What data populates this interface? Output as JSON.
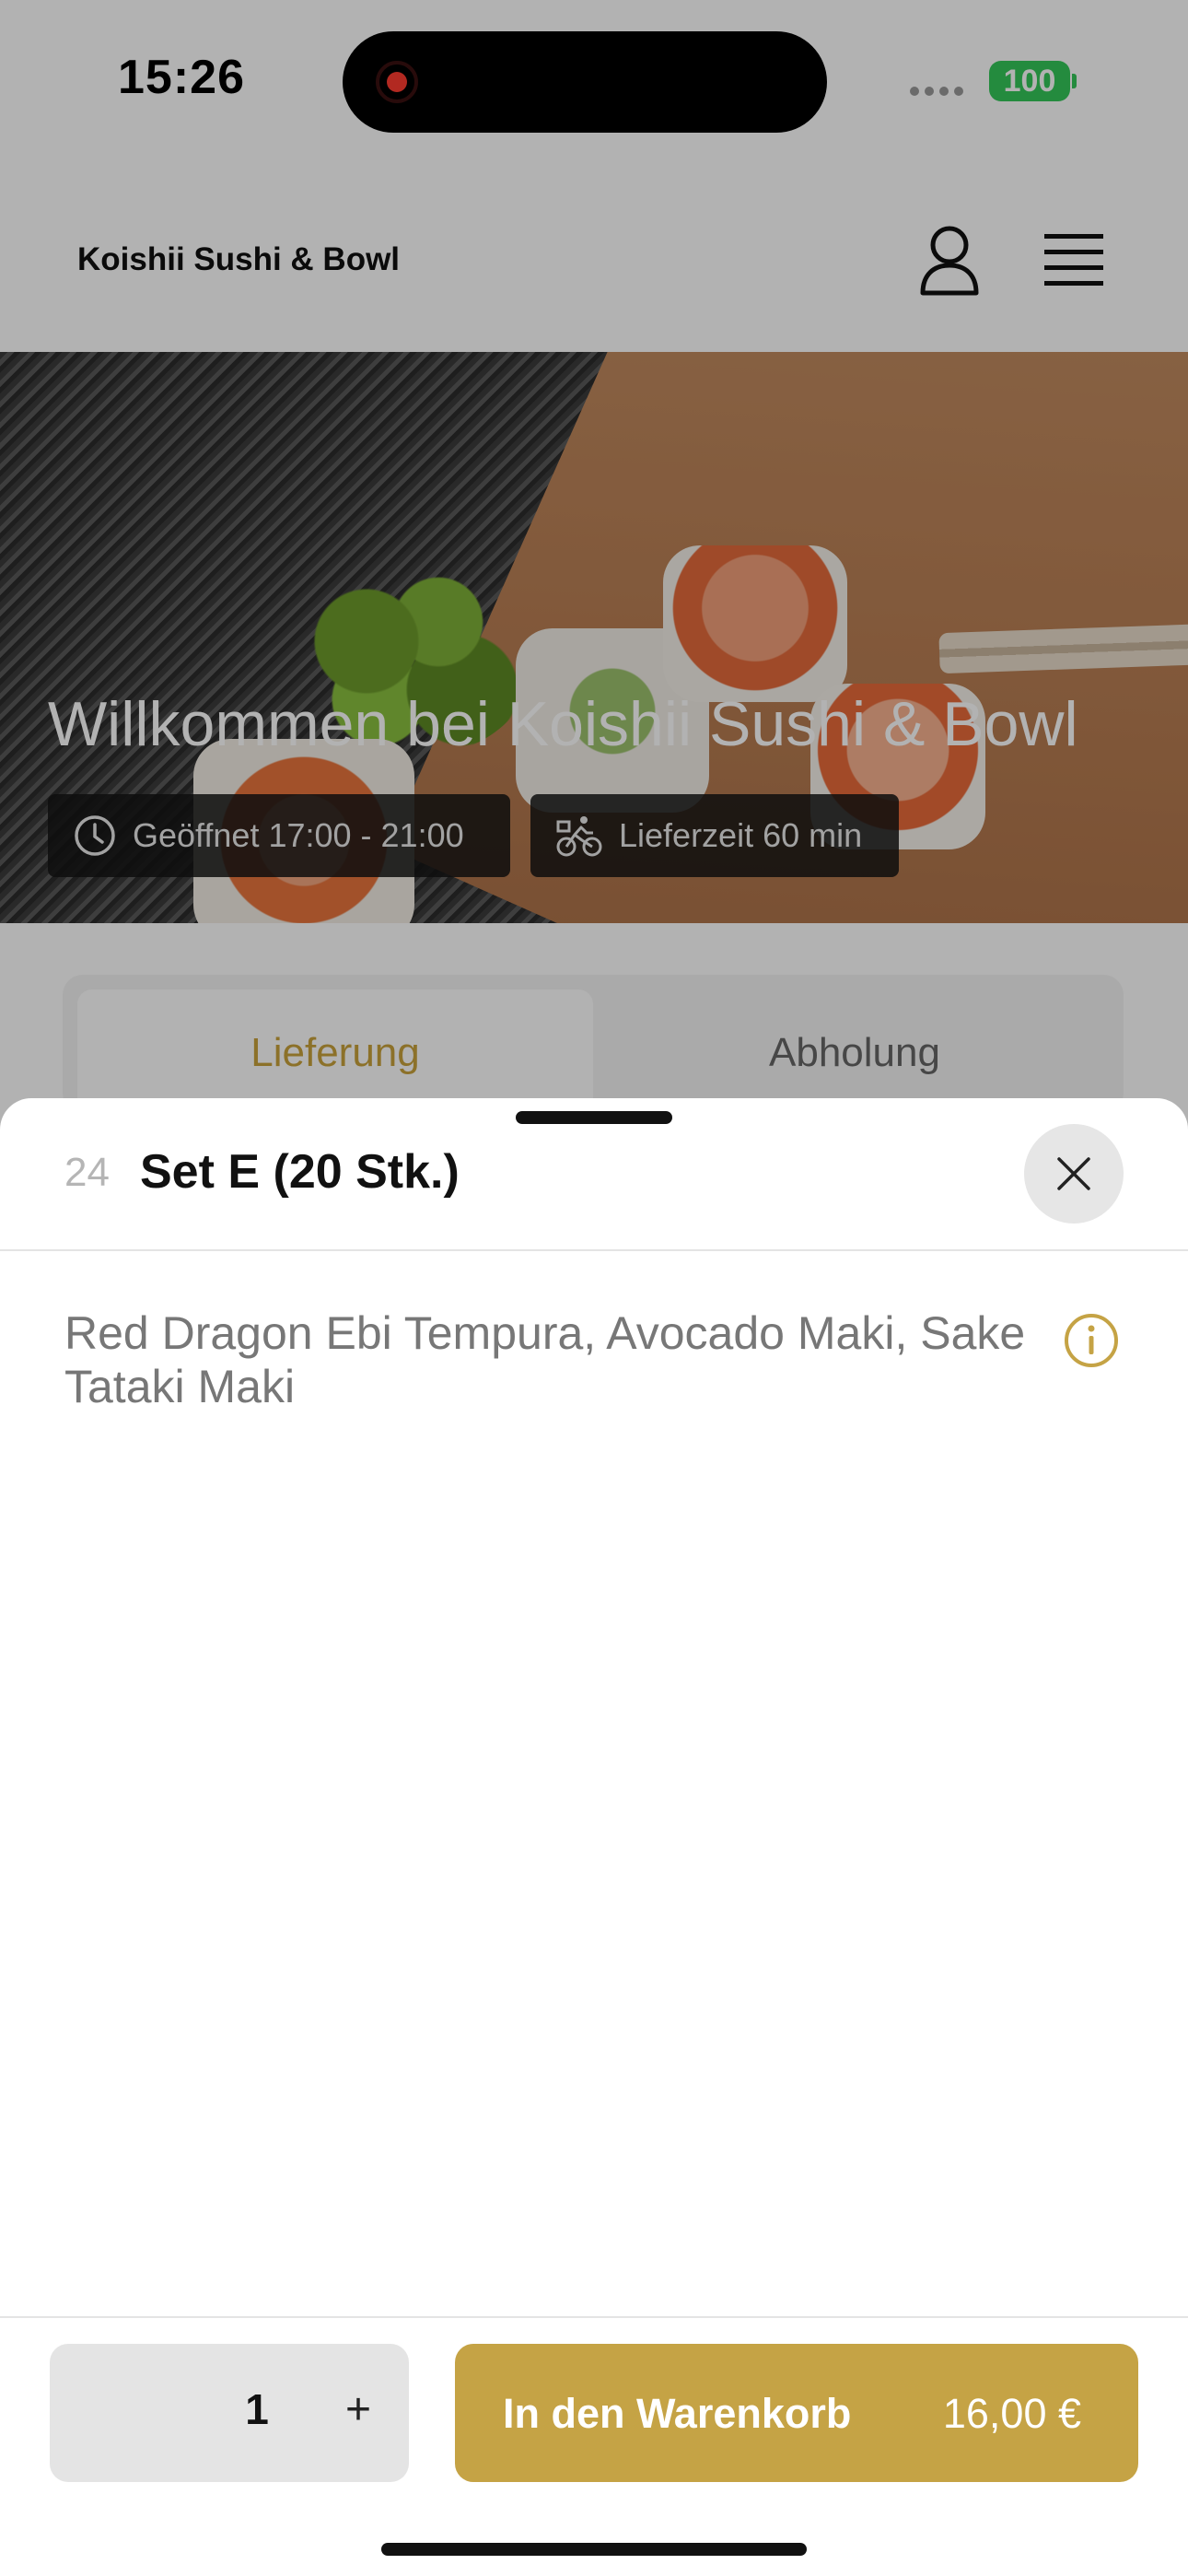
{
  "status_bar": {
    "time": "15:26",
    "battery": "100"
  },
  "header": {
    "brand": "Koishii Sushi & Bowl"
  },
  "hero": {
    "title": "Willkommen bei Koishii Sushi & Bowl",
    "opening_hours": "Geöffnet 17:00 - 21:00",
    "delivery_time": "Lieferzeit 60 min"
  },
  "tabs": {
    "delivery": "Lieferung",
    "pickup": "Abholung",
    "selected": "delivery"
  },
  "sheet": {
    "item_number": "24",
    "item_title": "Set E (20 Stk.)",
    "description": "Red Dragon Ebi Tempura, Avocado Maki, Sake Tataki Maki",
    "quantity": "1",
    "plus_label": "+",
    "add_to_cart_label": "In den Warenkorb",
    "price": "16,00 €"
  },
  "colors": {
    "accent": "#c5a345",
    "battery": "#34c759",
    "recording": "#ff3b30"
  },
  "icons": [
    "record-icon",
    "signal-icon",
    "battery-icon",
    "user-icon",
    "menu-icon",
    "clock-icon",
    "bicycle-icon",
    "close-icon",
    "info-icon"
  ]
}
